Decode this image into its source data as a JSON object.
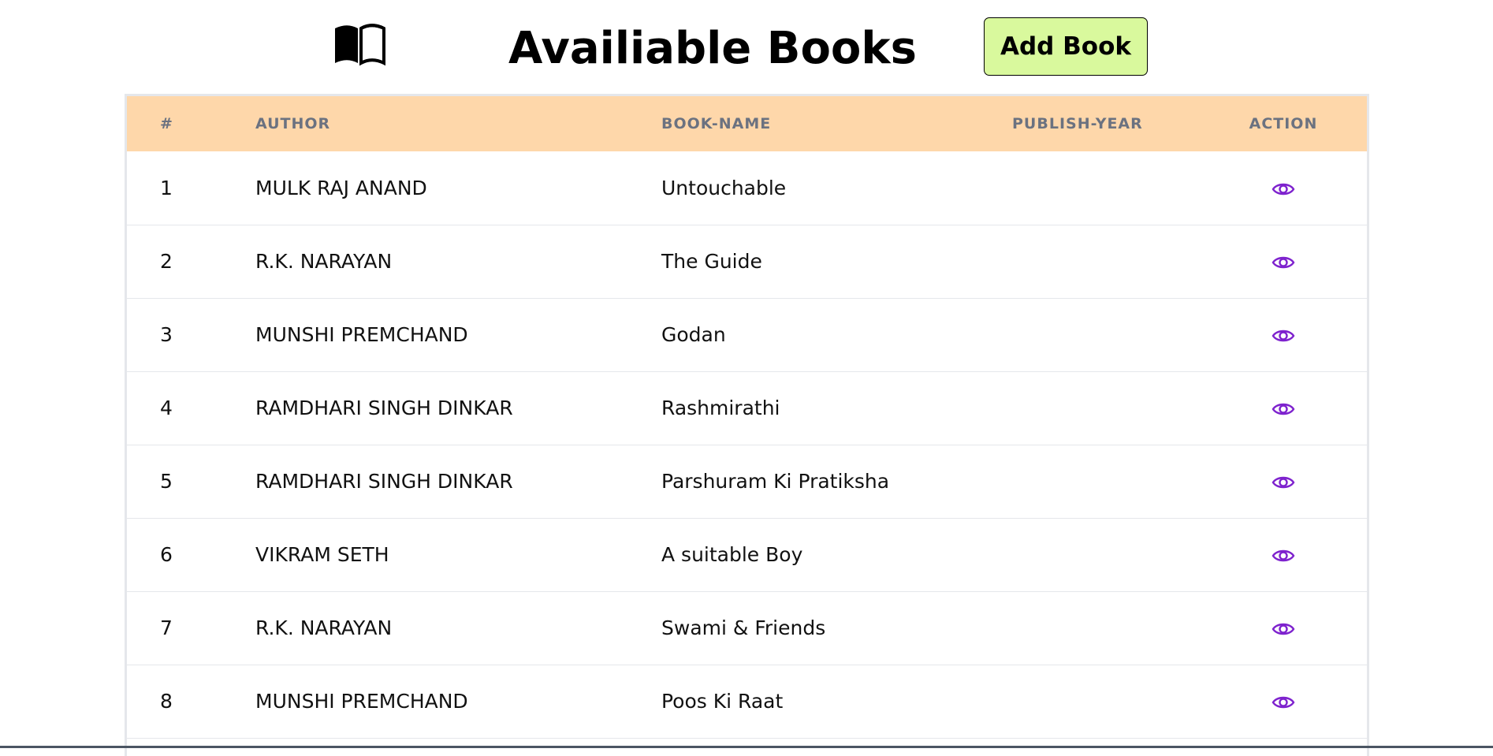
{
  "header": {
    "title": "Availiable Books",
    "add_button_label": "Add Book",
    "icon": "open-book-icon"
  },
  "table": {
    "columns": [
      "#",
      "AUTHOR",
      "BOOK-NAME",
      "PUBLISH-YEAR",
      "ACTION"
    ],
    "rows": [
      {
        "num": "1",
        "author": "MULK RAJ ANAND",
        "book": "Untouchable",
        "year": ""
      },
      {
        "num": "2",
        "author": "R.K. NARAYAN",
        "book": "The Guide",
        "year": ""
      },
      {
        "num": "3",
        "author": "MUNSHI PREMCHAND",
        "book": "Godan",
        "year": ""
      },
      {
        "num": "4",
        "author": "RAMDHARI SINGH DINKAR",
        "book": "Rashmirathi",
        "year": ""
      },
      {
        "num": "5",
        "author": "RAMDHARI SINGH DINKAR",
        "book": "Parshuram Ki Pratiksha",
        "year": ""
      },
      {
        "num": "6",
        "author": "VIKRAM SETH",
        "book": "A suitable Boy",
        "year": ""
      },
      {
        "num": "7",
        "author": "R.K. NARAYAN",
        "book": "Swami & Friends",
        "year": ""
      },
      {
        "num": "8",
        "author": "MUNSHI PREMCHAND",
        "book": "Poos Ki Raat",
        "year": ""
      }
    ],
    "action_icon": "eye-icon"
  },
  "colors": {
    "header_row": "#fed7aa",
    "add_button": "#d9f99d",
    "eye_icon": "#7e22ce"
  }
}
